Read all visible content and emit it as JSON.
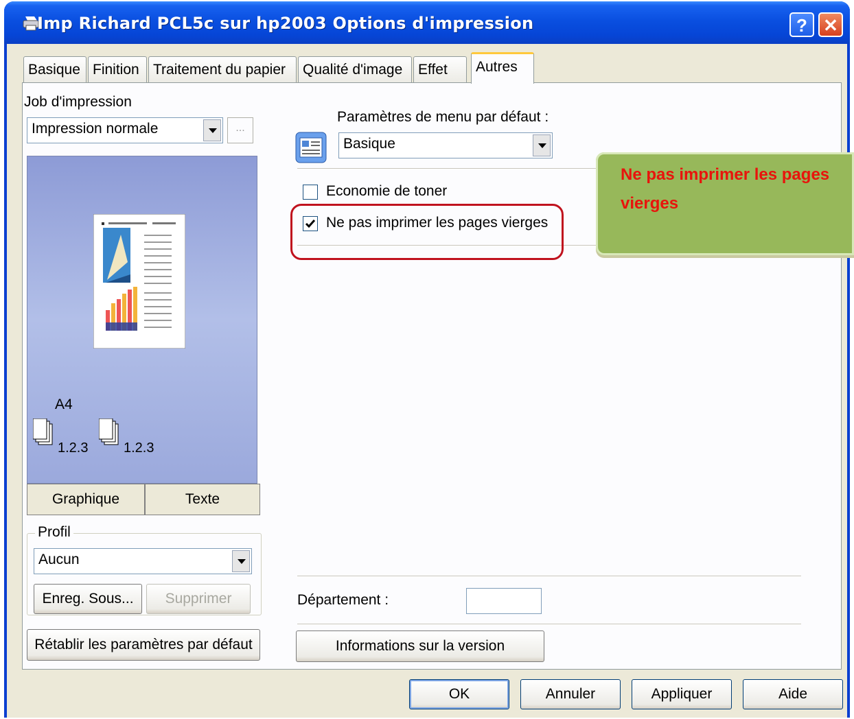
{
  "window": {
    "title": "Imp Richard PCL5c sur hp2003 Options d'impression",
    "help_glyph": "?",
    "close_glyph": "✕"
  },
  "tabs": [
    {
      "label": "Basique",
      "active": false
    },
    {
      "label": "Finition",
      "active": false
    },
    {
      "label": "Traitement du papier",
      "active": false
    },
    {
      "label": "Qualité d'image",
      "active": false
    },
    {
      "label": "Effet",
      "active": false
    },
    {
      "label": "Autres",
      "active": true
    }
  ],
  "left": {
    "job_label": "Job d'impression",
    "job_value": "Impression normale",
    "ellipsis": "...",
    "paper_size": "A4",
    "collate_label_1": "1.2.3",
    "collate_label_2": "1.2.3",
    "view_tabs": [
      "Graphique",
      "Texte"
    ],
    "profile_group": "Profil",
    "profile_value": "Aucun",
    "save_as": "Enreg. Sous...",
    "delete": "Supprimer",
    "restore": "Rétablir les paramètres par défaut"
  },
  "right": {
    "menu_label": "Paramètres de menu par défaut :",
    "menu_value": "Basique",
    "toner_label": "Economie de toner",
    "toner_checked": false,
    "skip_blank_label": "Ne pas imprimer les pages vierges",
    "skip_blank_checked": true,
    "department_label": "Département :",
    "department_value": "",
    "version_button": "Informations sur la version"
  },
  "callout": {
    "text": "Ne pas imprimer les pages vierges",
    "text_color": "#e8140c",
    "fill_color": "#97b85a"
  },
  "footer": {
    "ok": "OK",
    "cancel": "Annuler",
    "apply": "Appliquer",
    "help": "Aide"
  },
  "colors": {
    "titlebar": "#0a4fe0",
    "highlight_ring": "#c0121e",
    "tab_accent": "#ffc83c",
    "preview_bg": "#9aa8d8"
  }
}
